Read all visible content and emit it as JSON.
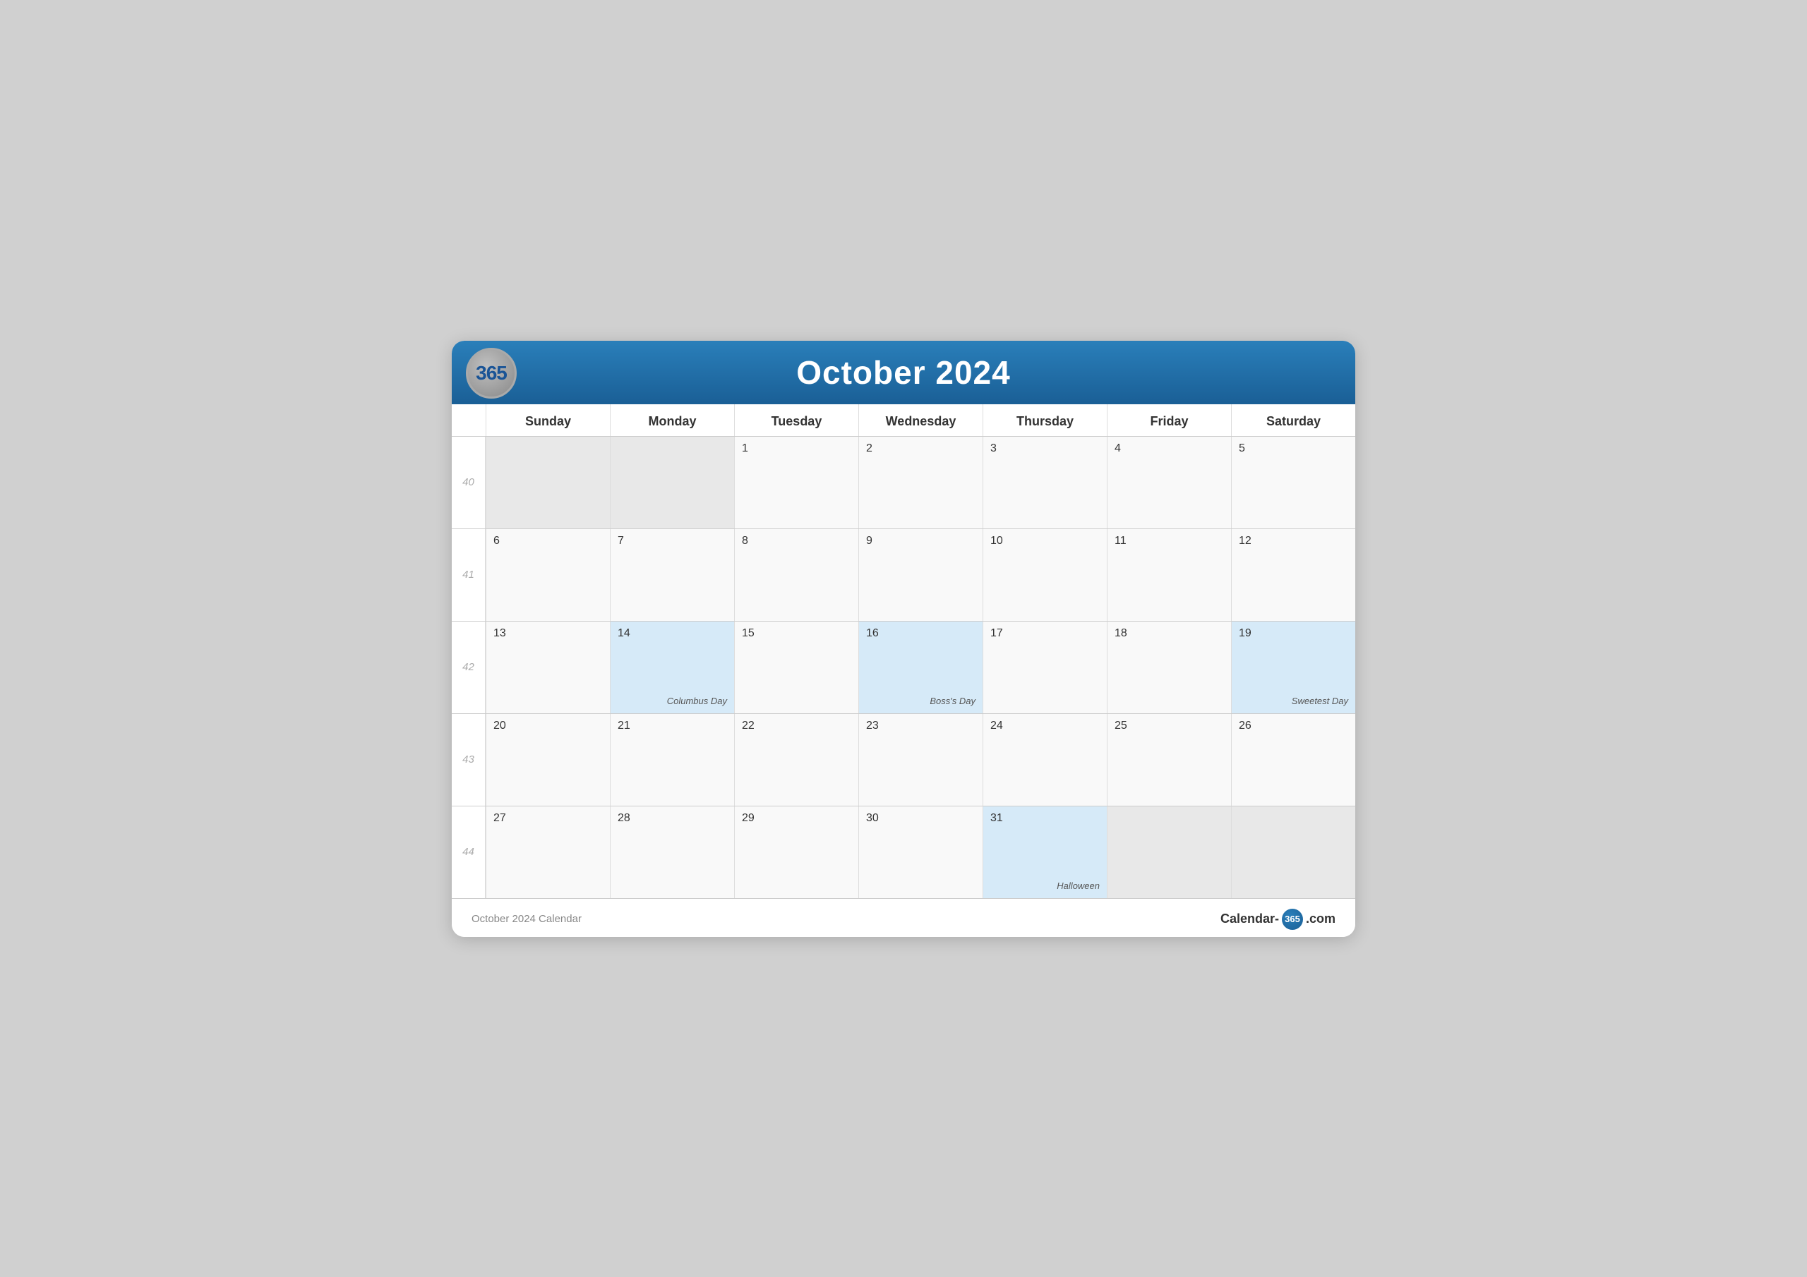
{
  "header": {
    "logo": "365",
    "title": "October 2024"
  },
  "day_headers": [
    "Sunday",
    "Monday",
    "Tuesday",
    "Wednesday",
    "Thursday",
    "Friday",
    "Saturday"
  ],
  "weeks": [
    {
      "week_num": "40",
      "days": [
        {
          "day": "",
          "in_month": false,
          "highlighted": false,
          "event": ""
        },
        {
          "day": "",
          "in_month": false,
          "highlighted": false,
          "event": ""
        },
        {
          "day": "1",
          "in_month": true,
          "highlighted": false,
          "event": ""
        },
        {
          "day": "2",
          "in_month": true,
          "highlighted": false,
          "event": ""
        },
        {
          "day": "3",
          "in_month": true,
          "highlighted": false,
          "event": ""
        },
        {
          "day": "4",
          "in_month": true,
          "highlighted": false,
          "event": ""
        },
        {
          "day": "5",
          "in_month": true,
          "highlighted": false,
          "event": ""
        }
      ]
    },
    {
      "week_num": "41",
      "days": [
        {
          "day": "6",
          "in_month": true,
          "highlighted": false,
          "event": ""
        },
        {
          "day": "7",
          "in_month": true,
          "highlighted": false,
          "event": ""
        },
        {
          "day": "8",
          "in_month": true,
          "highlighted": false,
          "event": ""
        },
        {
          "day": "9",
          "in_month": true,
          "highlighted": false,
          "event": ""
        },
        {
          "day": "10",
          "in_month": true,
          "highlighted": false,
          "event": ""
        },
        {
          "day": "11",
          "in_month": true,
          "highlighted": false,
          "event": ""
        },
        {
          "day": "12",
          "in_month": true,
          "highlighted": false,
          "event": ""
        }
      ]
    },
    {
      "week_num": "42",
      "days": [
        {
          "day": "13",
          "in_month": true,
          "highlighted": false,
          "event": ""
        },
        {
          "day": "14",
          "in_month": true,
          "highlighted": true,
          "event": "Columbus Day"
        },
        {
          "day": "15",
          "in_month": true,
          "highlighted": false,
          "event": ""
        },
        {
          "day": "16",
          "in_month": true,
          "highlighted": true,
          "event": "Boss's Day"
        },
        {
          "day": "17",
          "in_month": true,
          "highlighted": false,
          "event": ""
        },
        {
          "day": "18",
          "in_month": true,
          "highlighted": false,
          "event": ""
        },
        {
          "day": "19",
          "in_month": true,
          "highlighted": true,
          "event": "Sweetest Day"
        }
      ]
    },
    {
      "week_num": "43",
      "days": [
        {
          "day": "20",
          "in_month": true,
          "highlighted": false,
          "event": ""
        },
        {
          "day": "21",
          "in_month": true,
          "highlighted": false,
          "event": ""
        },
        {
          "day": "22",
          "in_month": true,
          "highlighted": false,
          "event": ""
        },
        {
          "day": "23",
          "in_month": true,
          "highlighted": false,
          "event": ""
        },
        {
          "day": "24",
          "in_month": true,
          "highlighted": false,
          "event": ""
        },
        {
          "day": "25",
          "in_month": true,
          "highlighted": false,
          "event": ""
        },
        {
          "day": "26",
          "in_month": true,
          "highlighted": false,
          "event": ""
        }
      ]
    },
    {
      "week_num": "44",
      "days": [
        {
          "day": "27",
          "in_month": true,
          "highlighted": false,
          "event": ""
        },
        {
          "day": "28",
          "in_month": true,
          "highlighted": false,
          "event": ""
        },
        {
          "day": "29",
          "in_month": true,
          "highlighted": false,
          "event": ""
        },
        {
          "day": "30",
          "in_month": true,
          "highlighted": false,
          "event": ""
        },
        {
          "day": "31",
          "in_month": true,
          "highlighted": true,
          "event": "Halloween"
        },
        {
          "day": "",
          "in_month": false,
          "highlighted": false,
          "event": ""
        },
        {
          "day": "",
          "in_month": false,
          "highlighted": false,
          "event": ""
        }
      ]
    }
  ],
  "footer": {
    "left": "October 2024 Calendar",
    "right_prefix": "Calendar-",
    "right_num": "365",
    "right_suffix": ".com"
  }
}
